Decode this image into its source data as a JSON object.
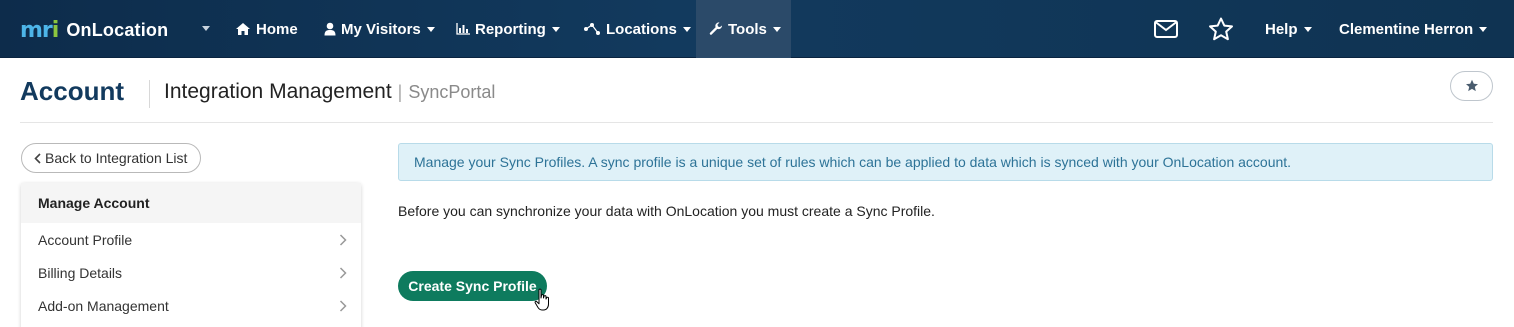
{
  "navbar": {
    "brand_logo": "mri",
    "brand_name": "OnLocation",
    "items": [
      {
        "label": "Home",
        "icon": "home-icon"
      },
      {
        "label": "My Visitors",
        "icon": "user-icon"
      },
      {
        "label": "Reporting",
        "icon": "bar-chart-icon"
      },
      {
        "label": "Locations",
        "icon": "network-icon"
      },
      {
        "label": "Tools",
        "icon": "wrench-icon",
        "active": true
      }
    ],
    "mail_icon": "envelope-icon",
    "star_icon": "star-icon",
    "help_label": "Help",
    "user_name": "Clementine Herron"
  },
  "header": {
    "title": "Account",
    "subtitle": "Integration Management",
    "separator": "|",
    "subtitle_context": "SyncPortal",
    "favorite_icon": "star-icon"
  },
  "sidebar": {
    "back_label": "Back to Integration List",
    "panel_title": "Manage Account",
    "items": [
      {
        "label": "Account Profile"
      },
      {
        "label": "Billing Details"
      },
      {
        "label": "Add-on Management"
      }
    ]
  },
  "main": {
    "alert_text": "Manage your Sync Profiles. A sync profile is a unique set of rules which can be applied to data which is synced with your OnLocation account.",
    "intro_text": "Before you can synchronize your data with OnLocation you must create a Sync Profile.",
    "create_button_label": "Create Sync Profile"
  },
  "colors": {
    "navbar_bg": "#123a5e",
    "active_nav_bg": "#2b4a69",
    "title_color": "#123a5e",
    "alert_bg": "#dff1f8",
    "alert_text": "#2d7397",
    "primary_button": "#0e7b5e",
    "logo_m_r": "#4db5e8",
    "logo_i": "#8cc63f"
  }
}
